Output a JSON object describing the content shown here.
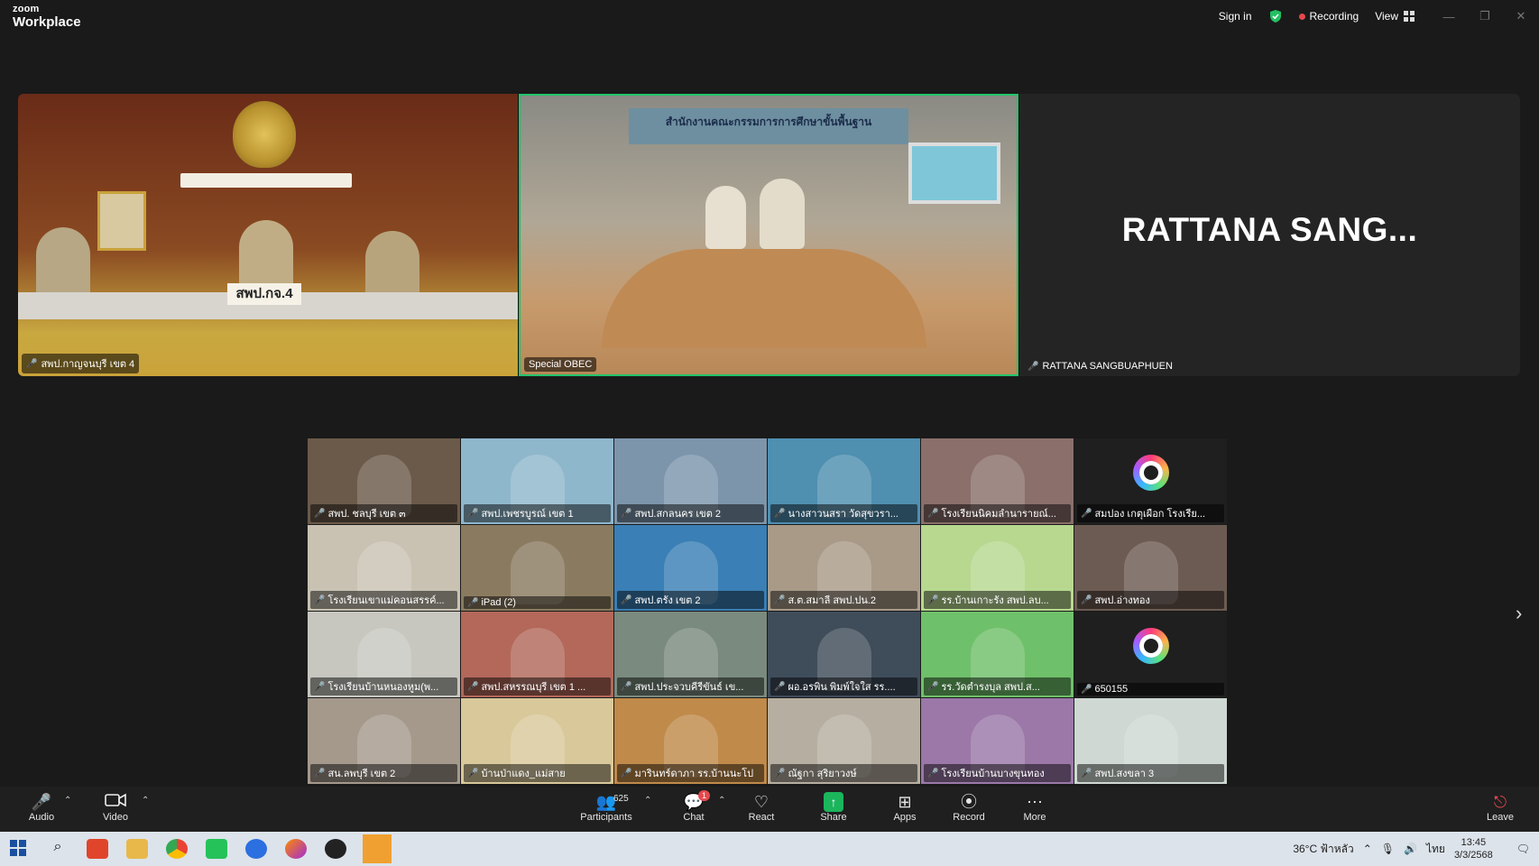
{
  "titlebar": {
    "brand_small": "zoom",
    "brand_main": "Workplace",
    "sign_in": "Sign in",
    "recording": "Recording",
    "view": "View"
  },
  "speakers": [
    {
      "label": "สพป.กาญจนบุรี เขต 4",
      "sign_text": "สพป.กจ.4"
    },
    {
      "label": "Special OBEC",
      "banner_text": "สำนักงานคณะกรรมการการศึกษาขั้นพื้นฐาน"
    },
    {
      "label": "RATTANA SANGBUAPHUEN",
      "display_name": "RATTANA  SANG..."
    }
  ],
  "gallery": [
    {
      "label": "สพป. ชลบุรี เขต ๓",
      "bg": "#6b5a4a"
    },
    {
      "label": "สพป.เพชรบูรณ์ เขต 1",
      "bg": "#8fb7cc"
    },
    {
      "label": "สพป.สกลนคร เขต 2",
      "bg": "#7c95ab"
    },
    {
      "label": "นางสาวนสรา วัดสุขวรา...",
      "bg": "#4f8fb0"
    },
    {
      "label": "โรงเรียนนิคมลำนารายณ์...",
      "bg": "#8a6f6a"
    },
    {
      "label": "สมปอง เกตุเผือก โรงเรีย...",
      "bg": "#1f1f1f",
      "avatar": true
    },
    {
      "label": "โรงเรียนเขาแม่คอนสรรค์...",
      "bg": "#c9c2b2"
    },
    {
      "label": "iPad (2)",
      "bg": "#8a7b60"
    },
    {
      "label": "สพป.ตรัง เขต 2",
      "bg": "#3a7fb5"
    },
    {
      "label": "ส.ต.สมาลี  สพป.ปน.2",
      "bg": "#a99a88"
    },
    {
      "label": "รร.บ้านเกาะรัง สพป.ลบ...",
      "bg": "#b8d890"
    },
    {
      "label": "สพป.อ่างทอง",
      "bg": "#6c5b52"
    },
    {
      "label": "โรงเรียนบ้านหนองหูม(พ...",
      "bg": "#c7c7c0"
    },
    {
      "label": "สพป.สหรรณบุรี เขต 1 ...",
      "bg": "#b3685a"
    },
    {
      "label": "สพป.ประจวบคีรีขันธ์ เข...",
      "bg": "#7a8a7e"
    },
    {
      "label": "ผอ.อรพิน พิมพ์ใจใส รร....",
      "bg": "#3f4c5a"
    },
    {
      "label": "รร.วัดตำรงบุล  สพป.ส...",
      "bg": "#6fc06a"
    },
    {
      "label": "650155",
      "bg": "#1f1f1f",
      "avatar": true
    },
    {
      "label": "สน.ลพบุรี เขต 2",
      "bg": "#a5998c"
    },
    {
      "label": "บ้านป่าแดง_แม่สาย",
      "bg": "#d9c89a"
    },
    {
      "label": "มารินทร์ดาภา รร.บ้านนะโป",
      "bg": "#c08a4a"
    },
    {
      "label": "ณัฐกา สุริยาวงษ์",
      "bg": "#b6aea0"
    },
    {
      "label": "โรงเรียนบ้านบางขุนทอง",
      "bg": "#9b78a8"
    },
    {
      "label": "สพป.สงขลา 3",
      "bg": "#cfd8d2"
    }
  ],
  "toolbar": {
    "audio": "Audio",
    "video": "Video",
    "participants": "Participants",
    "participants_count": "625",
    "chat": "Chat",
    "chat_badge": "1",
    "react": "React",
    "share": "Share",
    "apps": "Apps",
    "record": "Record",
    "more": "More",
    "leave": "Leave"
  },
  "taskbar": {
    "weather": "36°C  ฟ้าหลัว",
    "lang": "ไทย",
    "time": "13:45",
    "date": "3/3/2568"
  }
}
